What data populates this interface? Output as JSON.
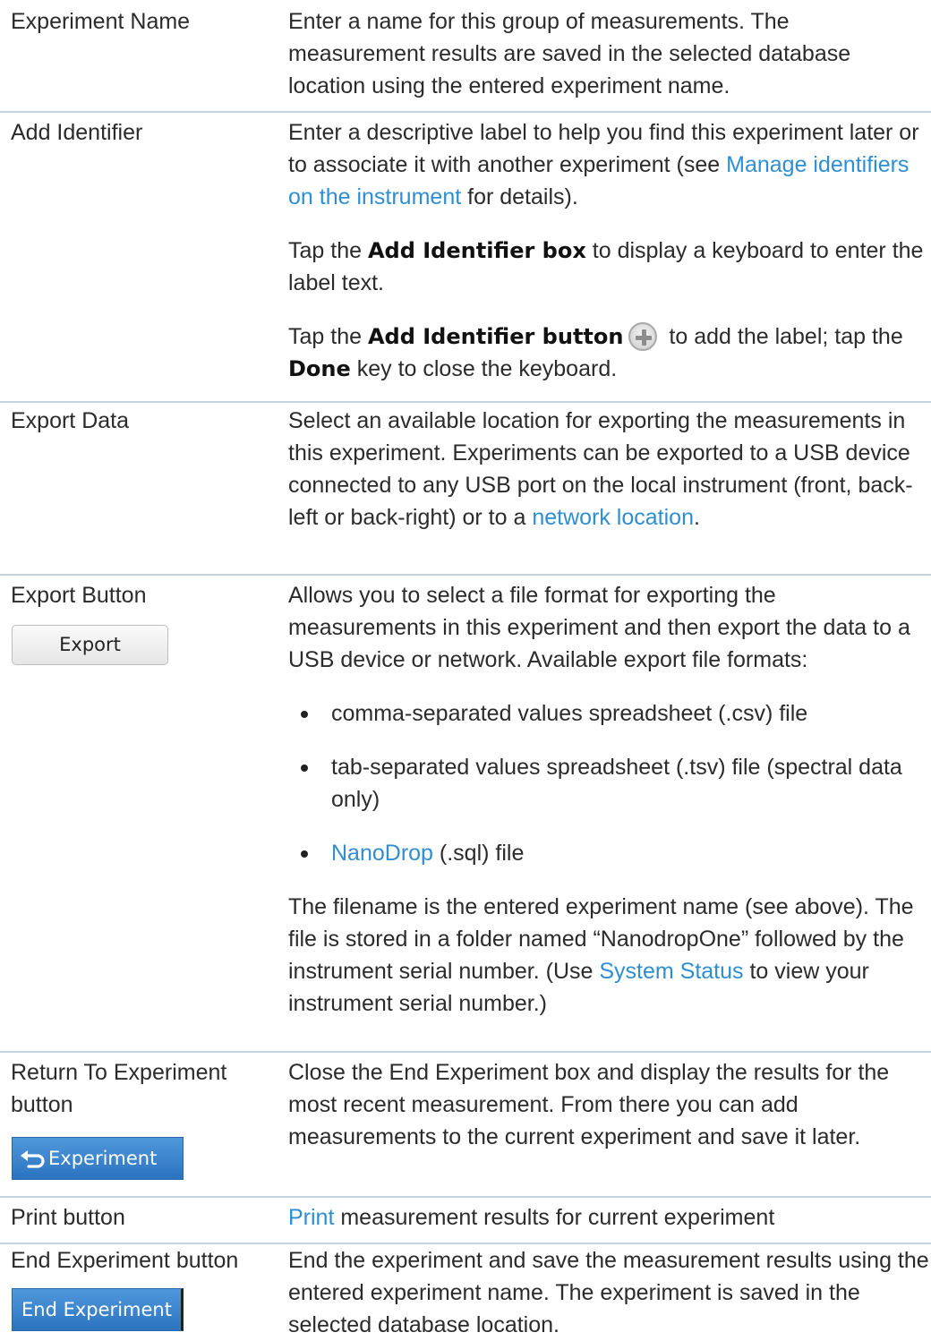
{
  "rows": {
    "experiment_name": {
      "label": "Experiment Name",
      "desc": "Enter a name for this group of measurements. The measurement results are saved in the selected database location using the entered experiment name."
    },
    "add_identifier": {
      "label": "Add Identifier",
      "p1_a": "Enter a descriptive label to help you find this experiment later or to associate it with another experiment (see ",
      "p1_link": "Manage identifiers on the instrument",
      "p1_b": " for details).",
      "p2_a": "Tap the ",
      "p2_bold": "Add Identifier box",
      "p2_b": " to display a keyboard to enter the label text.",
      "p3_a": "Tap the ",
      "p3_bold": "Add Identifier button",
      "p3_b": " to add the label; tap the ",
      "p3_bold2": "Done",
      "p3_c": " key to close the keyboard."
    },
    "export_data": {
      "label": "Export Data",
      "desc_a": "Select an available location for exporting the measurements in this experiment. Experiments can be exported to a USB device connected to any USB port on the local instrument (front, back-left or back-right) or to a ",
      "desc_link": "network location",
      "desc_b": "."
    },
    "export_button": {
      "label": "Export Button",
      "button_label": "Export",
      "p1": "Allows you to select a file format for exporting the measurements in this experiment and then export the data to a USB device or network. Available export file formats:",
      "bullet1": "comma-separated values spreadsheet (.csv) file",
      "bullet2": "tab-separated values spreadsheet (.tsv) file (spectral data only)",
      "bullet3_link": "NanoDrop",
      "bullet3_rest": " (.sql) file",
      "p2_a": "The filename is the entered experiment name (see above). The file is stored in a folder named “NanodropOne” followed by the instrument serial number. (Use ",
      "p2_link": "System Status",
      "p2_b": " to view your instrument serial number.)"
    },
    "return_button": {
      "label": "Return To Experiment button",
      "button_label": "Experiment",
      "desc": "Close the End Experiment box and display the results for the most recent measurement. From there you can add measurements to the current experiment and save it later."
    },
    "print_button": {
      "label": "Print button",
      "desc_link": "Print",
      "desc_rest": " measurement results for current experiment"
    },
    "end_button": {
      "label": "End Experiment button",
      "button_label": "End Experiment",
      "desc": "End the experiment and save the measurement results using the entered experiment name. The experiment is saved in the selected database location."
    }
  },
  "colors": {
    "link": "#2e8ed1",
    "divider": "#c5d3e0",
    "button_blue": "#3a83cd"
  }
}
